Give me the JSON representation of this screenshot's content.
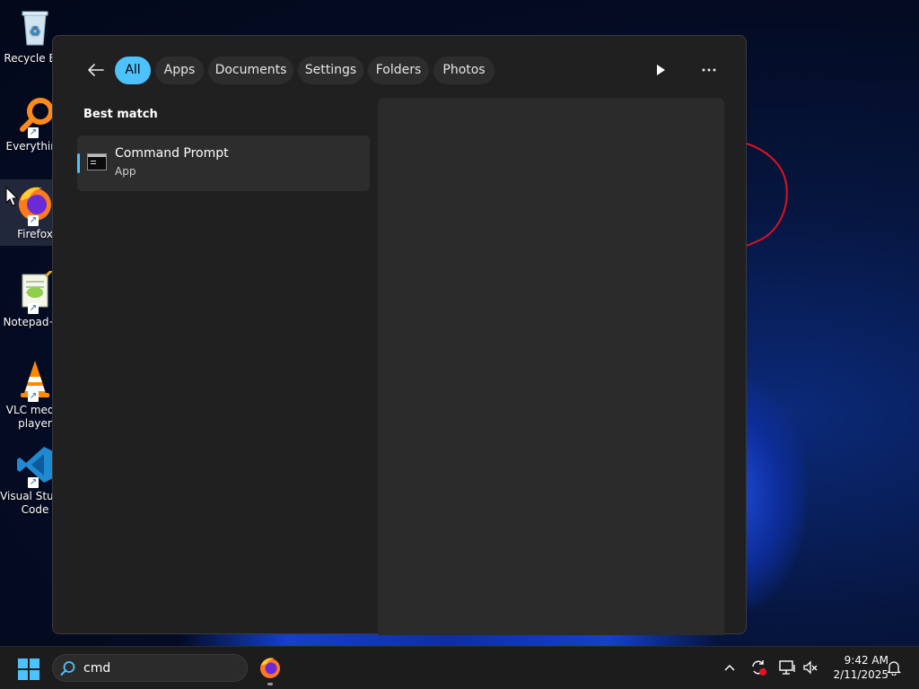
{
  "desktop": {
    "icons": [
      {
        "label": "Recycle Bin",
        "icon": "recycle-bin-icon"
      },
      {
        "label": "Everything",
        "icon": "everything-search-icon"
      },
      {
        "label": "Firefox",
        "icon": "firefox-icon"
      },
      {
        "label": "Notepad++",
        "icon": "notepad-plus-plus-icon"
      },
      {
        "label_line1": "VLC media",
        "label_line2": "player",
        "icon": "vlc-icon"
      },
      {
        "label_line1": "Visual Studio",
        "label_line2": "Code",
        "icon": "vscode-icon"
      }
    ]
  },
  "search_panel": {
    "filters": [
      {
        "label": "All",
        "active": true
      },
      {
        "label": "Apps"
      },
      {
        "label": "Documents"
      },
      {
        "label": "Settings"
      },
      {
        "label": "Folders"
      },
      {
        "label": "Photos"
      }
    ],
    "best_match_title": "Best match",
    "result": {
      "title": "Command Prompt",
      "subtitle": "App",
      "icon": "command-prompt-icon"
    }
  },
  "taskbar": {
    "search_value": "cmd",
    "pinned_app": "firefox-icon",
    "clock": {
      "time": "9:42 AM",
      "date": "2/11/2025"
    }
  },
  "colors": {
    "accent": "#4cc2ff",
    "panel_bg": "#202020",
    "chip_bg": "#2d2d2d",
    "taskbar_bg": "#1c1c1c"
  }
}
